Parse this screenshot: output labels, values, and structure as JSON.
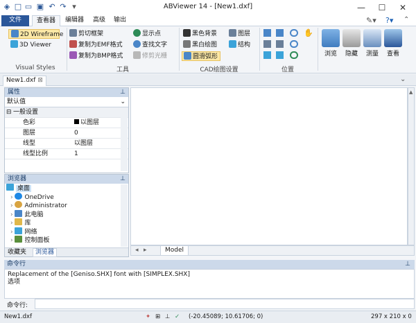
{
  "titlebar": {
    "title": "ABViewer 14 - [New1.dxf]",
    "quick_access_icons": [
      "app-icon",
      "new-icon",
      "open-icon",
      "save-icon",
      "undo-icon",
      "redo-icon",
      "customize-icon"
    ]
  },
  "tabs": [
    {
      "label": "文件"
    },
    {
      "label": "查看器"
    },
    {
      "label": "编辑器"
    },
    {
      "label": "高级"
    },
    {
      "label": "输出"
    }
  ],
  "ribbon": {
    "visual_styles": {
      "label": "Visual Styles",
      "items": [
        "2D Wireframe",
        "3D Viewer"
      ]
    },
    "tools": {
      "label": "工具",
      "col1": [
        "剪切框架",
        "复制为EMF格式",
        "复制为BMP格式"
      ],
      "col2": [
        "显示点",
        "查找文字",
        "修剪光栅"
      ]
    },
    "cad": {
      "label": "CAD绘图设置",
      "col1": [
        "黑色背景",
        "黑白绘图",
        "圆滑弧形"
      ],
      "col2": [
        "图层",
        "结构"
      ]
    },
    "position": {
      "label": "位置"
    },
    "big_buttons": [
      "浏览",
      "隐藏",
      "测量",
      "查看"
    ]
  },
  "doc_tab": {
    "label": "New1.dxf"
  },
  "properties": {
    "header": "属性",
    "combo_value": "默认值",
    "section": "一般设置",
    "rows": [
      {
        "name": "色彩",
        "value": "以图层"
      },
      {
        "name": "图层",
        "value": "0"
      },
      {
        "name": "线型",
        "value": "以图层"
      },
      {
        "name": "线型比例",
        "value": "1"
      }
    ]
  },
  "browser": {
    "header": "浏览器",
    "root": "桌面",
    "items": [
      "OneDrive",
      "Administrator",
      "此电脑",
      "库",
      "网络",
      "控制面板"
    ],
    "tabs": [
      "收藏夹",
      "浏览器"
    ]
  },
  "model_tab": {
    "label": "Model"
  },
  "command": {
    "header": "命令行",
    "output_lines": [
      "Replacement of the [Geniso.SHX] font with [SIMPLEX.SHX]",
      "选项"
    ],
    "input_label": "命令行:"
  },
  "status": {
    "file": "New1.dxf",
    "coords": "(-20.45089; 10.61706; 0)",
    "size": "297 x 210 x 0"
  },
  "colors": {
    "accent": "#2b579a",
    "panel_header": "#ccd9ea"
  }
}
